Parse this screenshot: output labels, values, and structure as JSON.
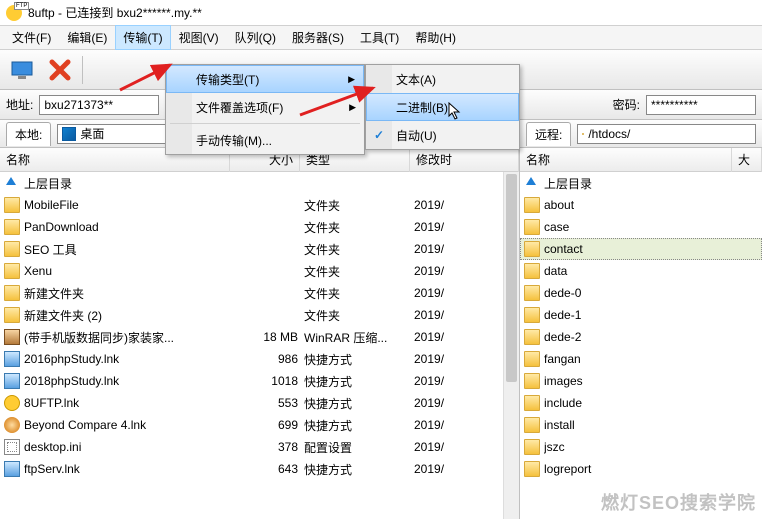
{
  "title": "8uftp - 已连接到 bxu2******.my.**",
  "menubar": [
    "文件(F)",
    "编辑(E)",
    "传输(T)",
    "视图(V)",
    "队列(Q)",
    "服务器(S)",
    "工具(T)",
    "帮助(H)"
  ],
  "active_menu_index": 2,
  "submenu1": {
    "items": [
      {
        "label": "传输类型(T)",
        "arrow": true,
        "hover": true
      },
      {
        "label": "文件覆盖选项(F)",
        "arrow": true
      },
      {
        "sep": true
      },
      {
        "label": "手动传输(M)..."
      }
    ]
  },
  "submenu2": {
    "items": [
      {
        "label": "文本(A)"
      },
      {
        "label": "二进制(B)",
        "hover": true
      },
      {
        "label": "自动(U)",
        "check": true
      }
    ]
  },
  "addr_label": "地址:",
  "addr_value": "bxu271373**",
  "pass_label": "密码:",
  "pass_value": "**********",
  "local_label": "本地:",
  "local_path": "桌面",
  "remote_label": "远程:",
  "remote_path": "/htdocs/",
  "cols_left": {
    "name": "名称",
    "size": "大小",
    "type": "类型",
    "date": "修改时"
  },
  "cols_right": {
    "name": "名称",
    "size": "大"
  },
  "parent_dir": "上层目录",
  "left_rows": [
    {
      "icon": "ic-folder",
      "name": "MobileFile",
      "size": "",
      "type": "文件夹",
      "date": "2019/"
    },
    {
      "icon": "ic-folder",
      "name": "PanDownload",
      "size": "",
      "type": "文件夹",
      "date": "2019/"
    },
    {
      "icon": "ic-folder",
      "name": "SEO 工具",
      "size": "",
      "type": "文件夹",
      "date": "2019/"
    },
    {
      "icon": "ic-folder",
      "name": "Xenu",
      "size": "",
      "type": "文件夹",
      "date": "2019/"
    },
    {
      "icon": "ic-folder",
      "name": "新建文件夹",
      "size": "",
      "type": "文件夹",
      "date": "2019/"
    },
    {
      "icon": "ic-folder",
      "name": "新建文件夹 (2)",
      "size": "",
      "type": "文件夹",
      "date": "2019/"
    },
    {
      "icon": "ic-rar",
      "name": "(带手机版数据同步)家装家...",
      "size": "18 MB",
      "type": "WinRAR 压缩...",
      "date": "2019/"
    },
    {
      "icon": "ic-lnk",
      "name": "2016phpStudy.lnk",
      "size": "986",
      "type": "快捷方式",
      "date": "2019/"
    },
    {
      "icon": "ic-lnk",
      "name": "2018phpStudy.lnk",
      "size": "1018",
      "type": "快捷方式",
      "date": "2019/"
    },
    {
      "icon": "ic-ftp",
      "name": "8UFTP.lnk",
      "size": "553",
      "type": "快捷方式",
      "date": "2019/"
    },
    {
      "icon": "ic-bc",
      "name": "Beyond Compare 4.lnk",
      "size": "699",
      "type": "快捷方式",
      "date": "2019/"
    },
    {
      "icon": "ic-ini",
      "name": "desktop.ini",
      "size": "378",
      "type": "配置设置",
      "date": "2019/"
    },
    {
      "icon": "ic-lnk",
      "name": "ftpServ.lnk",
      "size": "643",
      "type": "快捷方式",
      "date": "2019/"
    }
  ],
  "right_rows": [
    {
      "name": "about"
    },
    {
      "name": "case"
    },
    {
      "name": "contact",
      "sel": true
    },
    {
      "name": "data"
    },
    {
      "name": "dede-0"
    },
    {
      "name": "dede-1"
    },
    {
      "name": "dede-2"
    },
    {
      "name": "fangan"
    },
    {
      "name": "images"
    },
    {
      "name": "include"
    },
    {
      "name": "install"
    },
    {
      "name": "jszc"
    },
    {
      "name": "logreport"
    }
  ],
  "watermark": "燃灯SEO搜索学院"
}
